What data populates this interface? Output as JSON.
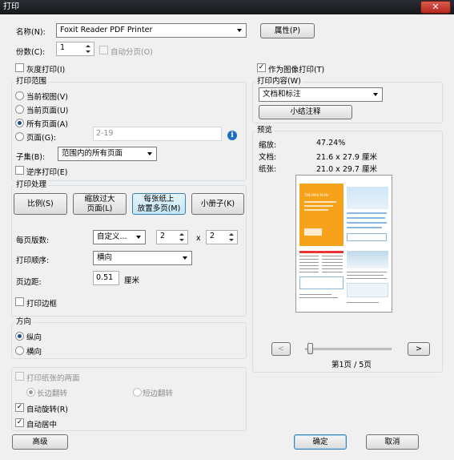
{
  "window": {
    "title": "打印",
    "close_glyph": "✕"
  },
  "printer": {
    "name_label": "名称(N):",
    "name_value": "Foxit Reader PDF Printer",
    "properties_button": "属性(P)",
    "copies_label": "份数(C):",
    "copies_value": "1",
    "collate_label": "自动分页(O)",
    "grayscale_label": "灰度打印(I)",
    "print_as_image_label": "作为图像打印(T)"
  },
  "print_range": {
    "title": "打印范围",
    "current_view": "当前视图(V)",
    "current_page": "当前页面(U)",
    "all_pages": "所有页面(A)",
    "pages_label": "页面(G):",
    "pages_value": "2-19",
    "subset_label": "子集(B):",
    "subset_value": "范围内的所有页面",
    "reverse_label": "逆序打印(E)"
  },
  "print_handling": {
    "title": "打印处理",
    "mode_scale": "比例(S)",
    "mode_fit_line1": "缩放过大",
    "mode_fit_line2": "页面(L)",
    "mode_multi_line1": "每张纸上",
    "mode_multi_line2": "放置多页(M)",
    "mode_booklet": "小册子(K)",
    "pages_per_sheet_label": "每页版数:",
    "pages_per_sheet_value": "自定义...",
    "cols_value": "2",
    "times": "x",
    "rows_value": "2",
    "order_label": "打印顺序:",
    "order_value": "横向",
    "margin_label": "页边距:",
    "margin_value": "0.51",
    "margin_unit": "厘米",
    "border_label": "打印边框"
  },
  "orientation": {
    "title": "方向",
    "portrait": "纵向",
    "landscape": "横向"
  },
  "duplex": {
    "both_sides_label": "打印纸张的两面",
    "long_edge": "长边翻转",
    "short_edge": "短边翻转",
    "auto_rotate": "自动旋转(R)",
    "auto_center": "自动居中"
  },
  "print_what": {
    "title": "打印内容(W)",
    "value": "文档和标注",
    "summary_button": "小结注释"
  },
  "preview": {
    "title": "预览",
    "zoom_label": "缩放:",
    "zoom_value": "47.24%",
    "doc_label": "文档:",
    "doc_value": "21.6 x 27.9 厘米",
    "paper_label": "纸张:",
    "paper_value": "21.0 x 29.7 厘米",
    "prev": "<",
    "next": ">",
    "page_indicator": "第1页 / 5页",
    "thumb_title": "THE MAX PLAN"
  },
  "footer": {
    "advanced": "高级",
    "ok": "确定",
    "cancel": "取消"
  },
  "colors": {
    "accent": "#f7a21b",
    "info_icon": "#1e6fc4",
    "titlebar": "#1c1e22"
  }
}
